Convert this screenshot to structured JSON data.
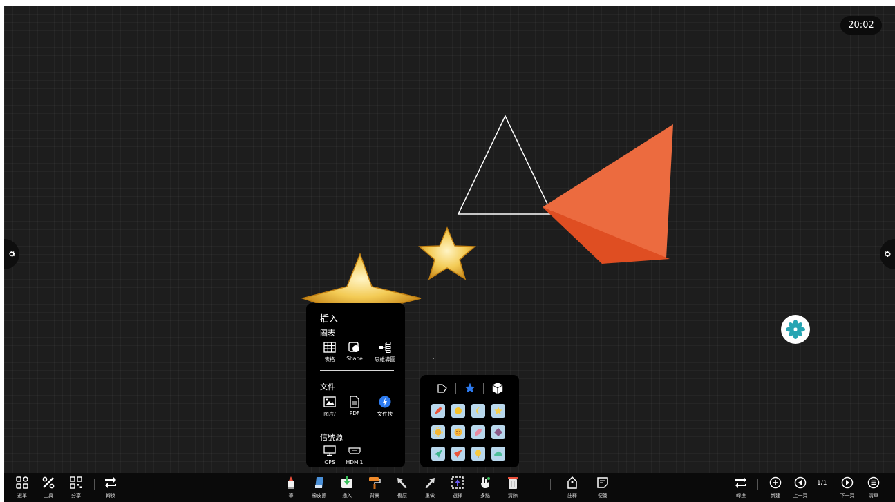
{
  "status": {
    "clock": "20:02"
  },
  "insert_panel": {
    "title": "插入",
    "chart_section": "圖表",
    "chart_items": [
      {
        "label": "表格",
        "icon": "table-icon"
      },
      {
        "label": "Shape",
        "icon": "shape-icon"
      },
      {
        "label": "思維導圖",
        "icon": "mindmap-icon"
      }
    ],
    "file_section": "文件",
    "file_items": [
      {
        "label": "图片/",
        "icon": "image-icon"
      },
      {
        "label": "PDF",
        "icon": "pdf-icon"
      },
      {
        "label": "文件快",
        "icon": "file-quick-icon"
      }
    ],
    "source_section": "信號源",
    "source_items": [
      {
        "label": "OPS",
        "icon": "monitor-icon"
      },
      {
        "label": "HDMI1",
        "icon": "hdmi-icon"
      }
    ]
  },
  "shape_panel": {
    "tabs": [
      "polygon-tab-icon",
      "star-tab-icon",
      "cube-tab-icon"
    ],
    "active_tab": 1,
    "stickers": [
      "pencil-sticker",
      "sun-sticker",
      "moon-sticker",
      "star-sticker",
      "sunburst-sticker",
      "face-sticker",
      "leaf-sticker",
      "diamond-sticker",
      "paper-plane-sticker",
      "kite-sticker",
      "balloon-sticker",
      "cloud-sticker"
    ]
  },
  "toolbar": {
    "left": [
      {
        "label": "選單",
        "icon": "menu-grid-icon"
      },
      {
        "label": "工具",
        "icon": "tools-icon"
      },
      {
        "label": "分享",
        "icon": "qr-share-icon"
      },
      {
        "label": "轉換",
        "icon": "switch-icon"
      }
    ],
    "center": [
      {
        "label": "筆",
        "icon": "pen-icon"
      },
      {
        "label": "橡皮擦",
        "icon": "eraser-icon"
      },
      {
        "label": "插入",
        "icon": "insert-icon"
      },
      {
        "label": "背景",
        "icon": "paint-roller-icon"
      },
      {
        "label": "復原",
        "icon": "undo-icon"
      },
      {
        "label": "重做",
        "icon": "redo-icon"
      },
      {
        "label": "選擇",
        "icon": "select-icon"
      },
      {
        "label": "多點",
        "icon": "multi-touch-icon"
      },
      {
        "label": "清除",
        "icon": "clear-icon"
      }
    ],
    "annot": [
      {
        "label": "註釋",
        "icon": "annotate-icon"
      },
      {
        "label": "便簽",
        "icon": "sticky-note-icon"
      }
    ],
    "right": {
      "switch_label": "轉換",
      "new_label": "新建",
      "prev_label": "上一頁",
      "page": "1/1",
      "next_label": "下一頁",
      "list_label": "清單"
    }
  },
  "colors": {
    "canvas": "#1d1d1d",
    "accent": "#2d7bf0",
    "shape_orange": "#e9622f",
    "star_gold": "#f1c74c"
  }
}
